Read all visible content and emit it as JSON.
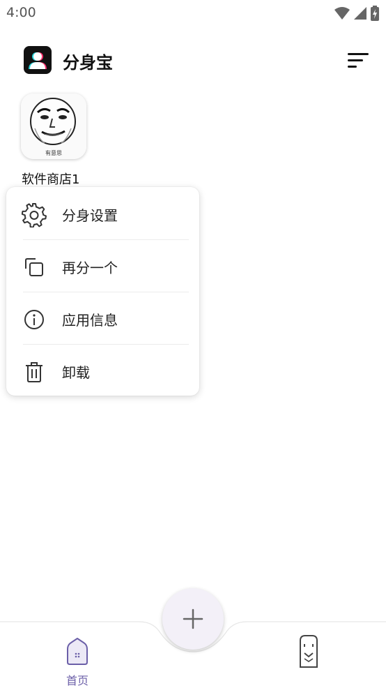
{
  "status_bar": {
    "time": "4:00"
  },
  "app_bar": {
    "title": "分身宝"
  },
  "app_tile": {
    "name": "软件商店1",
    "icon_caption": "有意思"
  },
  "context_menu": {
    "items": [
      {
        "label": "分身设置",
        "icon": "gear-icon"
      },
      {
        "label": "再分一个",
        "icon": "copy-icon"
      },
      {
        "label": "应用信息",
        "icon": "info-icon"
      },
      {
        "label": "卸载",
        "icon": "trash-icon"
      }
    ]
  },
  "bottom_nav": {
    "home_label": "首页"
  },
  "colors": {
    "accent": "#6b5fa8",
    "fab_bg": "#f3f0f8"
  }
}
